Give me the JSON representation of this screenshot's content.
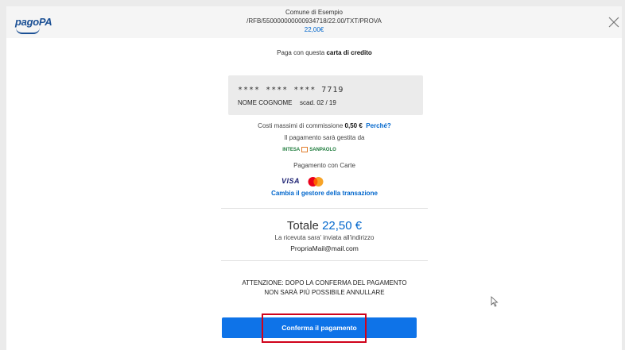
{
  "header": {
    "logo_text": "pagoPA",
    "entity": "Comune di Esempio",
    "reference": "/RFB/550000000000934718/22.00/TXT/PROVA",
    "amount": "22,00€",
    "close_icon": "close-icon"
  },
  "payment": {
    "pay_with_prefix": "Paga con questa ",
    "pay_with_bold": "carta di credito",
    "card": {
      "number": "**** **** **** 7719",
      "holder": "NOME COGNOME",
      "expiry": "scad. 02 / 19"
    },
    "fee_prefix": "Costi massimi di commissione ",
    "fee_value": "0,50 €",
    "fee_link": "Perché?",
    "managed_by": "Il pagamento sarà gestita da",
    "psp_name_left": "INTESA",
    "psp_name_right": "SANPAOLO",
    "cards_label": "Pagamento con Carte",
    "brands": [
      "VISA",
      "Mastercard"
    ],
    "change_link": "Cambia il gestore della transazione",
    "total_label": "Totale ",
    "total_value": "22,50 €",
    "receipt_note": "La ricevuta sara' inviata all'indirizzo",
    "email": "PropriaMail@mail.com",
    "warning_line1": "ATTENZIONE: DOPO LA CONFERMA DEL PAGAMENTO",
    "warning_line2": "NON SARÀ PIÙ POSSIBILE ANNULLARE",
    "confirm_label": "Conferma il pagamento"
  },
  "colors": {
    "accent": "#0e73e8",
    "link": "#0066cc",
    "highlight": "#d0021b"
  }
}
